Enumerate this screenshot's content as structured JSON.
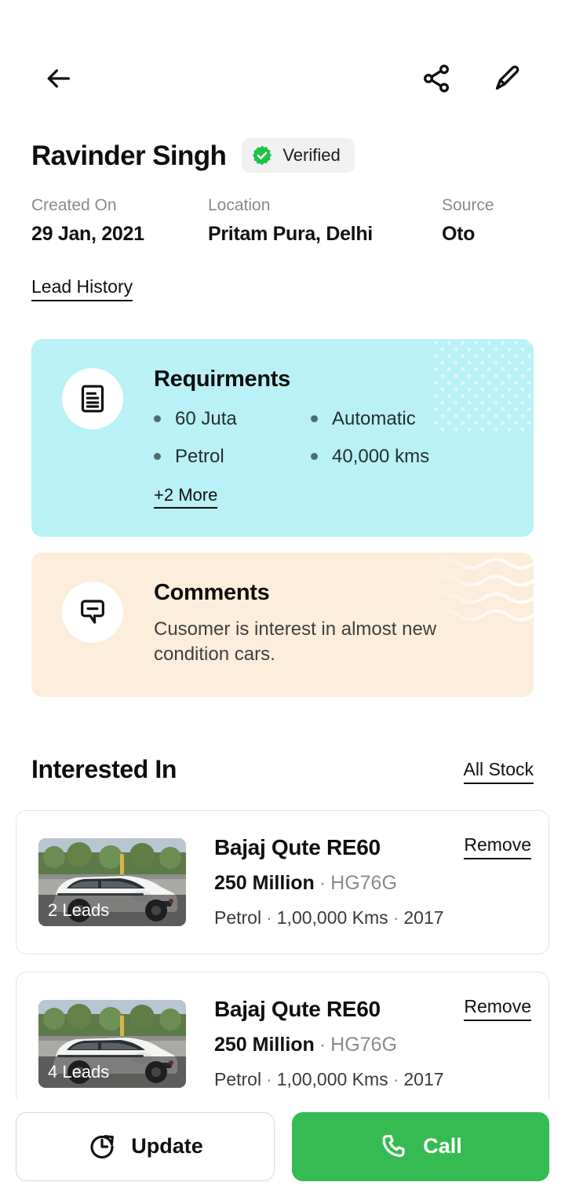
{
  "appbar": {
    "back_icon": "arrow-left-icon",
    "share_icon": "share-icon",
    "edit_icon": "pencil-icon"
  },
  "lead": {
    "name": "Ravinder Singh",
    "verified_label": "Verified",
    "verified_icon": "verified-check-icon",
    "meta": [
      {
        "label": "Created On",
        "value": "29 Jan, 2021"
      },
      {
        "label": "Location",
        "value": "Pritam Pura, Delhi"
      },
      {
        "label": "Source",
        "value": "Oto"
      }
    ],
    "history_link": "Lead History"
  },
  "requirements": {
    "title": "Requirments",
    "icon": "document-icon",
    "items": [
      "60 Juta",
      "Automatic",
      "Petrol",
      "40,000 kms"
    ],
    "more_link": "+2 More",
    "bg_color": "#b9f1f7"
  },
  "comments": {
    "title": "Comments",
    "icon": "comment-bubble-icon",
    "text": "Cusomer is interest in almost new condition cars.",
    "bg_color": "#fceeda"
  },
  "interested": {
    "title": "Interested In",
    "all_stock_link": "All Stock",
    "cars": [
      {
        "title": "Bajaj Qute RE60",
        "price": "250 Million",
        "reg": "HG76G",
        "fuel": "Petrol",
        "kms": "1,00,000 Kms",
        "year": "2017",
        "leads": "2 Leads",
        "remove_label": "Remove"
      },
      {
        "title": "Bajaj Qute RE60",
        "price": "250 Million",
        "reg": "HG76G",
        "fuel": "Petrol",
        "kms": "1,00,000 Kms",
        "year": "2017",
        "leads": "4 Leads",
        "remove_label": "Remove"
      }
    ]
  },
  "bottombar": {
    "update_label": "Update",
    "update_icon": "clock-refresh-icon",
    "call_label": "Call",
    "call_icon": "phone-icon",
    "call_color": "#35bb52"
  },
  "separator": "·"
}
